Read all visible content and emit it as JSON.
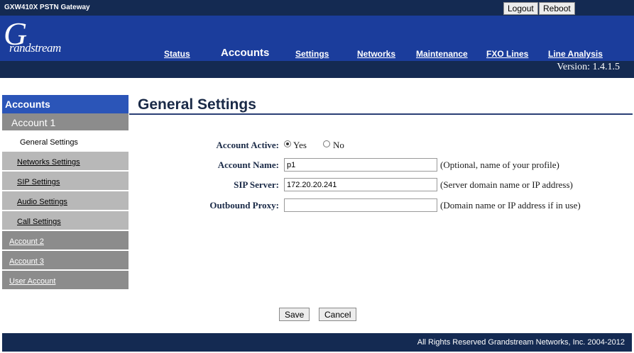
{
  "window": {
    "product_name": "GXW410X PSTN Gateway"
  },
  "top_buttons": {
    "logout": "Logout",
    "reboot": "Reboot"
  },
  "logo": {
    "glyph": "G",
    "word": "randstream"
  },
  "nav": {
    "status": "Status",
    "accounts": "Accounts",
    "settings": "Settings",
    "networks": "Networks",
    "maintenance": "Maintenance",
    "fxo_lines": "FXO Lines",
    "line_analysis": "Line Analysis",
    "active": "Accounts"
  },
  "version": "Version: 1.4.1.5",
  "sidebar": {
    "header": "Accounts",
    "account1": "Account 1",
    "items": {
      "general": "General Settings",
      "networks": "Networks Settings",
      "sip": "SIP Settings",
      "audio": "Audio Settings",
      "call": "Call Settings"
    },
    "account2": "Account 2",
    "account3": "Account 3",
    "user_account": "User Account"
  },
  "main": {
    "title": "General Settings",
    "account_active": {
      "label": "Account Active:",
      "yes": "Yes",
      "no": "No",
      "selected": "Yes"
    },
    "account_name": {
      "label": "Account Name:",
      "value": "p1",
      "hint": "(Optional, name of your profile)"
    },
    "sip_server": {
      "label": "SIP Server:",
      "value": "172.20.20.241",
      "hint": "(Server domain name or IP address)"
    },
    "outbound_proxy": {
      "label": "Outbound Proxy:",
      "value": "",
      "hint": "(Domain name or IP address if in use)"
    },
    "save": "Save",
    "cancel": "Cancel"
  },
  "footer": {
    "copyright": "All Rights Reserved Grandstream Networks, Inc. 2004-2012"
  },
  "colors": {
    "header_blue": "#1b3d9c",
    "dark_navy": "#142a52",
    "sidebar_blue": "#2b55b8",
    "sidebar_gray": "#8c8c8c",
    "sidebar_light": "#b8b8b8"
  }
}
